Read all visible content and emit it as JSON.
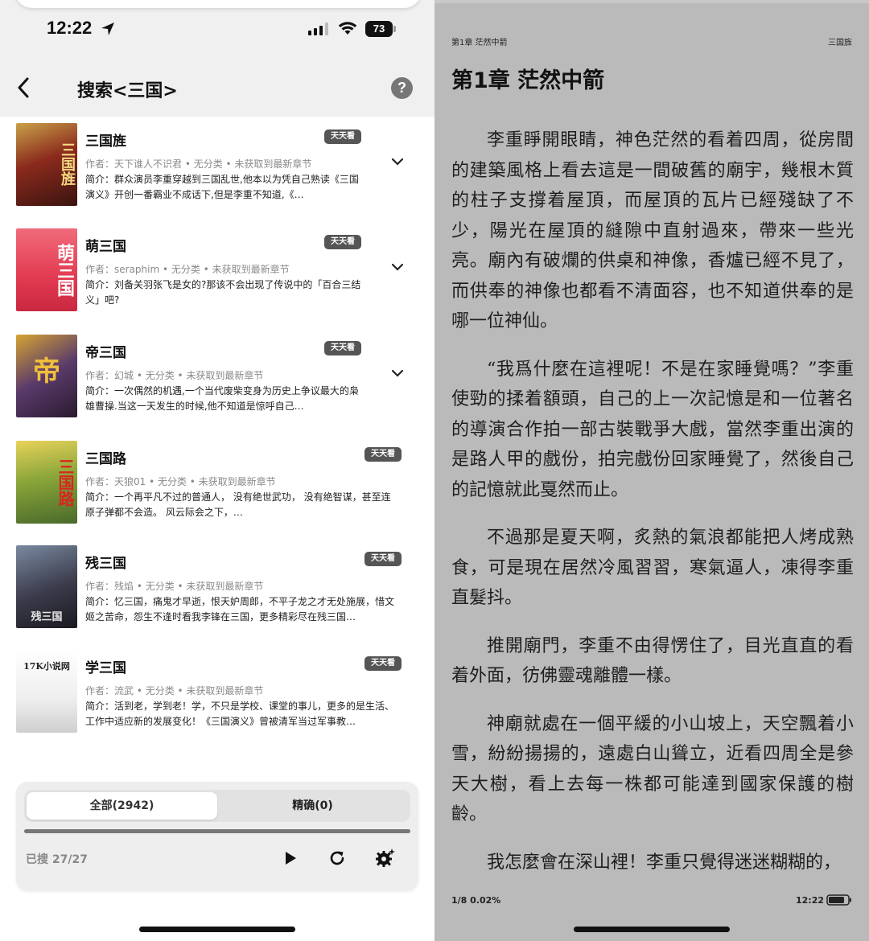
{
  "left": {
    "status": {
      "time": "12:22",
      "battery": "73"
    },
    "title": "搜索<三国>",
    "help_label": "?",
    "books": [
      {
        "name": "三国旌",
        "badge": "天天看",
        "meta": "作者：天下谁人不识君 • 无分类 • 未获取到最新章节",
        "intro": "简介：群众演员李重穿越到三国乱世,他本以为凭自己熟读《三国演义》开创一番霸业不成话下,但是李重不知道,《…",
        "cover_text": "三国旌",
        "cover_bg": "#7a2a1e",
        "cover_fg": "#f4d28a"
      },
      {
        "name": "萌三国",
        "badge": "天天看",
        "meta": "作者：seraphim • 无分类 • 未获取到最新章节",
        "intro": "简介：刘备关羽张飞是女的?那该不会出现了传说中的「百合三结义」吧?",
        "cover_text": "萌三国",
        "cover_bg": "#e2475a",
        "cover_fg": "#ffffff"
      },
      {
        "name": "帝三国",
        "badge": "天天看",
        "meta": "作者：幻城 • 无分类 • 未获取到最新章节",
        "intro": "简介：一次偶然的机遇,一个当代废柴变身为历史上争议最大的枭雄曹操.当这一天发生的时候,他不知道是惊呼自己…",
        "cover_text": "帝",
        "cover_bg": "#3b2a4a",
        "cover_fg": "#e9b83a"
      },
      {
        "name": "三国路",
        "badge": "天天看",
        "meta": "作者：天狼01 • 无分类 • 未获取到最新章节",
        "intro": "简介：一个再平凡不过的普通人， 没有绝世武功， 没有绝智谋，甚至连原子弹都不会造。 风云际会之下，…",
        "cover_text": "三国路",
        "cover_bg": "#6f8a2a",
        "cover_fg": "#d8261d"
      },
      {
        "name": "残三国",
        "badge": "天天看",
        "meta": "作者：残焰 • 无分类 • 未获取到最新章节",
        "intro": "简介：忆三国，痛鬼才早逝，恨天妒周郎，不平子龙之才无处施展，惜文姬之苦命，怨生不逢时看我李锋在三国，更多精彩尽在残三国…",
        "cover_text": "残三国",
        "cover_bg": "#3a3a4a",
        "cover_fg": "#dddddd"
      },
      {
        "name": "学三国",
        "badge": "天天看",
        "meta": "作者：流武 • 无分类 • 未获取到最新章节",
        "intro": "简介：活到老，学到老！学，不只是学校、课堂的事儿，更多的是生活、工作中适应新的发展变化！《三国演义》曾被清军当过军事教…",
        "cover_text": "17K小说网",
        "cover_bg": "#f4f4f4",
        "cover_fg": "#222222"
      }
    ],
    "tabs": {
      "all": "全部(2942)",
      "exact": "精确(0)"
    },
    "progress": {
      "searched": "已搜 27/27",
      "fraction": 1.0
    }
  },
  "right": {
    "chapter_small": "第1章 茫然中箭",
    "book_small": "三国旌",
    "chapter_title": "第1章 茫然中箭",
    "paragraphs": [
      "李重睜開眼睛，神色茫然的看着四周，從房間的建築風格上看去這是一間破舊的廟宇，幾根木質的柱子支撐着屋頂，而屋頂的瓦片已經殘缺了不少，陽光在屋頂的縫隙中直射過來，帶來一些光亮。廟內有破爛的供桌和神像，香爐已經不見了，而供奉的神像也都看不清面容，也不知道供奉的是哪一位神仙。",
      "“我爲什麼在這裡呢！不是在家睡覺嗎？”李重使勁的揉着額頭，自己的上一次記憶是和一位著名的導演合作拍一部古裝戰爭大戲，當然李重出演的是路人甲的戲份，拍完戲份回家睡覺了，然後自己的記憶就此戛然而止。",
      "不過那是夏天啊，炙熱的氣浪都能把人烤成熟食，可是現在居然冷風習習，寒氣逼人，凍得李重直髮抖。",
      "推開廟門，李重不由得愣住了，目光直直的看着外面，彷佛靈魂離體一樣。",
      "神廟就處在一個平緩的小山坡上，天空飄着小雪，紛紛揚揚的，遠處白山聳立，近看四周全是參天大樹，看上去每一株都可能達到國家保護的樹齡。",
      "我怎麼會在深山裡！李重只覺得迷迷糊糊的，"
    ],
    "footer_progress": "1/8  0.02%",
    "footer_time": "12:22"
  }
}
